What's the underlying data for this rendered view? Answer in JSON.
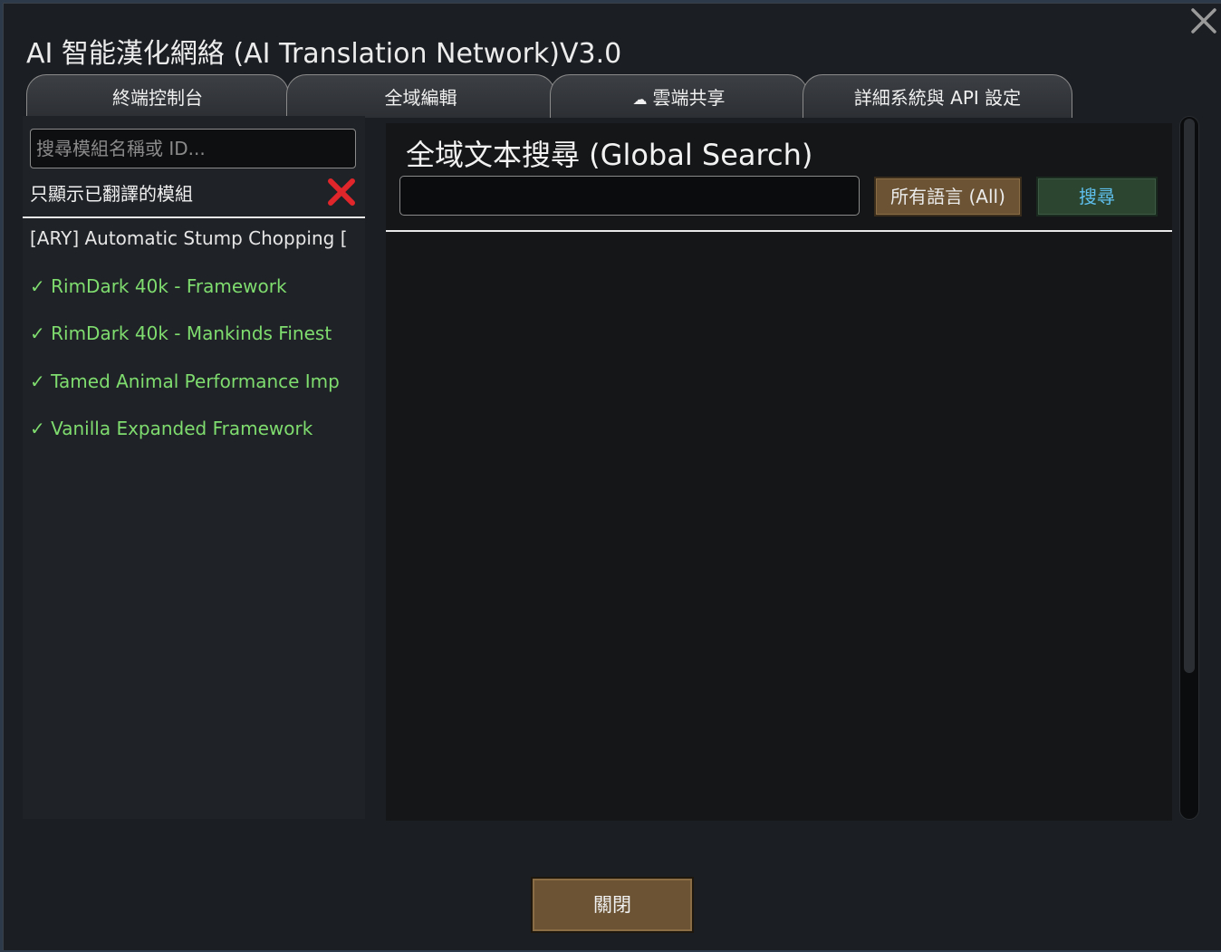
{
  "window": {
    "title": "AI 智能漢化網絡 (AI Translation Network)V3.0"
  },
  "tabs": [
    {
      "label": "終端控制台",
      "icon": ""
    },
    {
      "label": "全域編輯",
      "icon": ""
    },
    {
      "label": "雲端共享",
      "icon": "☁"
    },
    {
      "label": "詳細系統與 API 設定",
      "icon": ""
    }
  ],
  "sidebar": {
    "search_placeholder": "搜尋模組名稱或 ID...",
    "filter_label": "只顯示已翻譯的模組",
    "filter_icon": "red-x-icon",
    "mods": [
      {
        "label": "[ARY] Automatic Stump Chopping [",
        "translated": false
      },
      {
        "label": "✓ RimDark 40k - Framework",
        "translated": true
      },
      {
        "label": "✓ RimDark 40k - Mankinds Finest",
        "translated": true
      },
      {
        "label": "✓ Tamed Animal Performance Imp",
        "translated": true
      },
      {
        "label": "✓ Vanilla Expanded Framework",
        "translated": true
      }
    ]
  },
  "main": {
    "title": "全域文本搜尋 (Global Search)",
    "search_value": "",
    "language_button": "所有語言 (All)",
    "search_button": "搜尋"
  },
  "footer": {
    "close_button": "關閉"
  },
  "colors": {
    "translated_text": "#7fdc6e",
    "search_button_text": "#5fc0ee",
    "brown_button": "#6b5333",
    "green_button": "#2b4531"
  }
}
